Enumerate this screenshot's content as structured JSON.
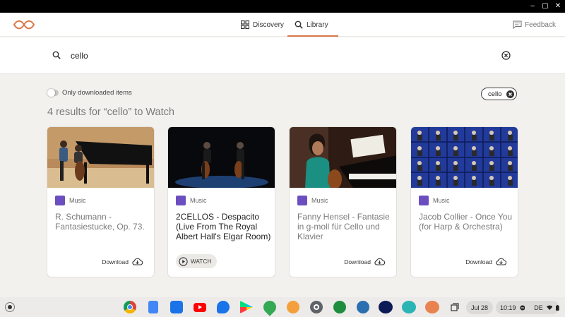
{
  "window": {
    "minimize": "‒",
    "maximize": "▢",
    "close": "✕"
  },
  "header": {
    "tabs": [
      {
        "label": "Discovery",
        "icon": "grid-icon",
        "active": false
      },
      {
        "label": "Library",
        "icon": "search-icon",
        "active": true
      }
    ],
    "feedback_label": "Feedback",
    "accent_color": "#d9784a"
  },
  "search": {
    "value": "cello"
  },
  "filters": {
    "downloaded_only_label": "Only downloaded items",
    "downloaded_only_enabled": false,
    "chip_label": "cello"
  },
  "results_title": "4 results for “cello” to Watch",
  "cards": [
    {
      "category": "Music",
      "title": "R. Schumann - Fantasiestucke, Op. 73.",
      "action": "Download",
      "featured": false
    },
    {
      "category": "Music",
      "title": "2CELLOS - Despacito (Live From The Royal Albert Hall's Elgar Room)",
      "action": "WATCH",
      "featured": true
    },
    {
      "category": "Music",
      "title": "Fanny Hensel - Fantasie in g-moll für Cello und Klavier",
      "action": "Download",
      "featured": false
    },
    {
      "category": "Music",
      "title": "Jacob Collier - Once You (for Harp & Orchestra)",
      "action": "Download",
      "featured": false
    }
  ],
  "shelf": {
    "apps": [
      "chrome-icon",
      "docs-icon",
      "files-icon",
      "youtube-icon",
      "messages-icon",
      "play-store-icon",
      "maps-icon",
      "app-icon",
      "settings-icon",
      "app-icon",
      "app-icon",
      "disney-plus-icon",
      "app-icon",
      "kolibri-icon"
    ],
    "date": "Jul 28",
    "time": "10:19",
    "locale": "DE"
  }
}
